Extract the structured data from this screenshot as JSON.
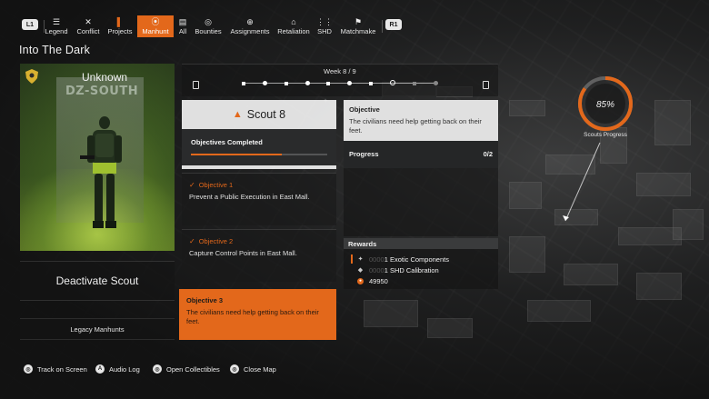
{
  "nav": {
    "lb": "L1",
    "rb": "R1",
    "tabs": [
      {
        "label": "Legend",
        "icon": "legend-icon"
      },
      {
        "label": "Conflict",
        "icon": "conflict-icon"
      },
      {
        "label": "Projects",
        "icon": "projects-icon"
      },
      {
        "label": "Manhunt",
        "icon": "manhunt-icon",
        "active": true
      },
      {
        "label": "All",
        "icon": "all-icon"
      },
      {
        "label": "Bounties",
        "icon": "bounties-icon"
      },
      {
        "label": "Assignments",
        "icon": "assignments-icon"
      },
      {
        "label": "Retaliation",
        "icon": "retaliation-icon"
      },
      {
        "label": "SHD",
        "icon": "shd-icon"
      },
      {
        "label": "Matchmake",
        "icon": "matchmake-icon"
      }
    ]
  },
  "page_title": "Into The Dark",
  "left": {
    "card_name": "Unknown",
    "gate_sign": "DZ-SOUTH",
    "deactivate_label": "Deactivate Scout",
    "legacy_label": "Legacy Manhunts"
  },
  "week": {
    "label": "Week 8 / 9",
    "current": 8,
    "total": 9
  },
  "scout": {
    "name": "Scout 8",
    "objectives_completed_label": "Objectives Completed",
    "objectives_completed": 2,
    "objectives_total": 3
  },
  "objectives": [
    {
      "title": "Objective 1",
      "desc": "Prevent a Public Execution in East Mall.",
      "done": true
    },
    {
      "title": "Objective 2",
      "desc": "Capture Control Points in East Mall.",
      "done": true
    },
    {
      "title": "Objective 3",
      "desc": "The civilians need help getting back on their feet.",
      "done": false,
      "selected": true
    }
  ],
  "detail": {
    "header": "Objective",
    "desc": "The civilians need help getting back on their feet.",
    "progress_label": "Progress",
    "progress_value": "0/2"
  },
  "rewards": {
    "header": "Rewards",
    "items": [
      {
        "zeros": "0000",
        "amount": "1",
        "name": "Exotic Components",
        "icon": "exotic-icon"
      },
      {
        "zeros": "0000",
        "amount": "1",
        "name": "SHD Calibration",
        "icon": "shd-calibration-icon"
      },
      {
        "zeros": "",
        "amount": "49950",
        "name": "",
        "icon": "xp-icon"
      }
    ]
  },
  "scouts_progress": {
    "value_label": "85%",
    "value": 0.85,
    "label": "Scouts Progress"
  },
  "footer": [
    {
      "label": "Track on Screen",
      "btn": "◎"
    },
    {
      "label": "Audio Log",
      "btn": "A"
    },
    {
      "label": "Open Collectibles",
      "btn": "◎"
    },
    {
      "label": "Close Map",
      "btn": "◎"
    }
  ],
  "colors": {
    "accent": "#e3681b",
    "panel_light": "#ebebeb",
    "panel_dark": "#2a2b2c"
  }
}
